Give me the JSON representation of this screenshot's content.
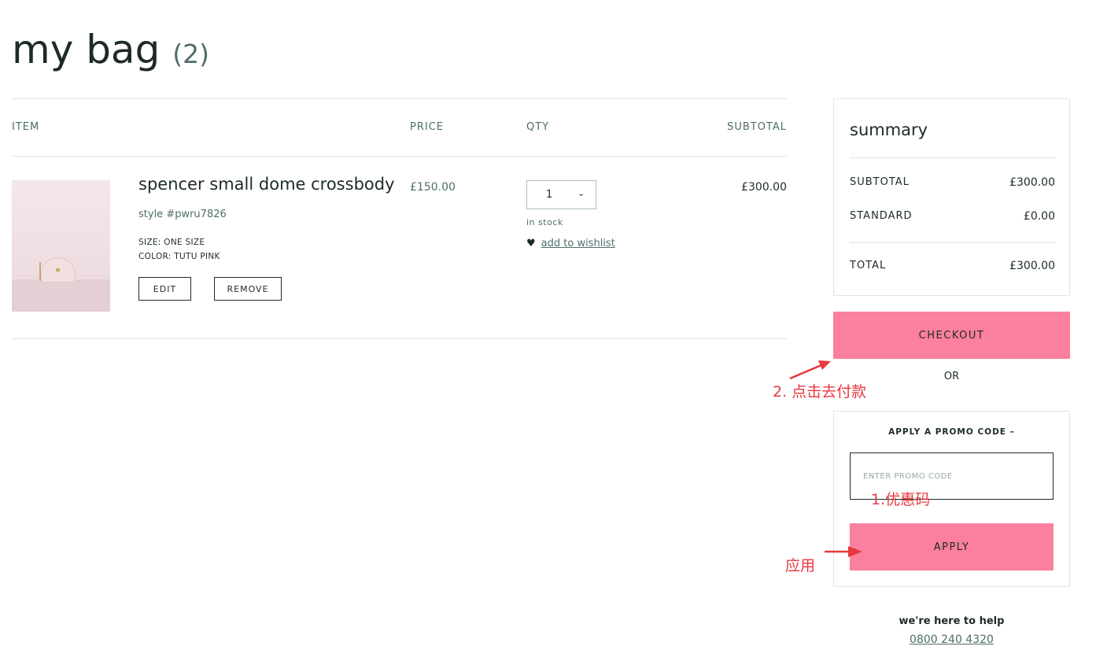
{
  "page": {
    "title": "my bag",
    "count": "(2)"
  },
  "table": {
    "headers": {
      "item": "ITEM",
      "price": "PRICE",
      "qty": "QTY",
      "subtotal": "SUBTOTAL"
    }
  },
  "item": {
    "name": "spencer small dome crossbody",
    "style": "style #pwru7826",
    "size": "SIZE: ONE SIZE",
    "color": "COLOR: TUTU PINK",
    "edit_label": "EDIT",
    "remove_label": "REMOVE",
    "price": "£150.00",
    "qty": "1",
    "qty_chevron": "⌄",
    "stock": "in stock",
    "wishlist_heart": "♥",
    "wishlist_label": "add to wishlist",
    "subtotal": "£300.00"
  },
  "summary": {
    "title": "summary",
    "subtotal_label": "SUBTOTAL",
    "subtotal_value": "£300.00",
    "shipping_label": "STANDARD",
    "shipping_value": "£0.00",
    "total_label": "TOTAL",
    "total_value": "£300.00"
  },
  "checkout": {
    "label": "CHECKOUT",
    "or": "OR"
  },
  "promo": {
    "toggle_label": "APPLY A PROMO CODE  –",
    "placeholder": "ENTER PROMO CODE",
    "apply_label": "APPLY"
  },
  "help": {
    "title": "we're here to help",
    "phone": "0800 240 4320"
  },
  "annotations": {
    "checkout_note": "2. 点击去付款",
    "promo_note": "1.优惠码",
    "apply_note": "应用"
  },
  "colors": {
    "accent_pink": "#fb7f9e",
    "text_dark": "#1d2a2a",
    "text_teal": "#4e6e6a",
    "annotation_red": "#e8383d"
  }
}
